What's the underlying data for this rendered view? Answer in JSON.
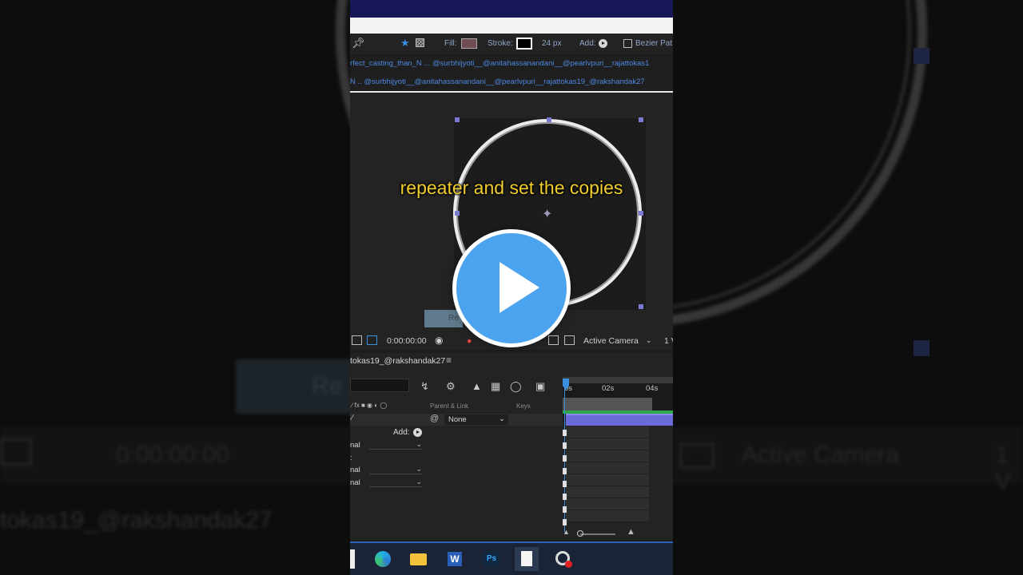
{
  "toolbar": {
    "fill_label": "Fill:",
    "stroke_label": "Stroke:",
    "stroke_width": "24 px",
    "add_label": "Add:",
    "bezier_label": "Bezier Pat"
  },
  "tabs": {
    "row1": "rfect_casting_than_N ... @surbhijyoti__@anitahassanandani__@pearlvpuri__rajattokas1",
    "row2": "N .. @surbhijyoti__@anitahassanandani__@pearlvpuri__rajattokas19_@rakshandak27"
  },
  "viewer": {
    "caption": "repeater and set the copies",
    "mini_button_label": "Re",
    "timecode": "0:00:00:00",
    "camera": "Active Camera",
    "views": "1 V"
  },
  "timeline": {
    "comp_tab": "tokas19_@rakshandak27",
    "ruler_labels": [
      "0s",
      "02s",
      "04s"
    ],
    "col_parent": "Parent & Link",
    "col_keys": "Keys",
    "parent_value": "None",
    "add_label": "Add:",
    "props": [
      "nal",
      "",
      "nal",
      "nal"
    ]
  },
  "background": {
    "timecode": "0:00:00:00",
    "camera": "Active Camera",
    "views": "1 V",
    "tab": "tokas19_@rakshandak27",
    "button": "Re"
  },
  "taskbar": {
    "word_letter": "W",
    "ps_letters": "Ps"
  },
  "colors": {
    "accent": "#4ba3ef",
    "caption": "#f1ce2f",
    "layer_bar": "#6a6ad8",
    "work_area_green": "#31a84a"
  }
}
